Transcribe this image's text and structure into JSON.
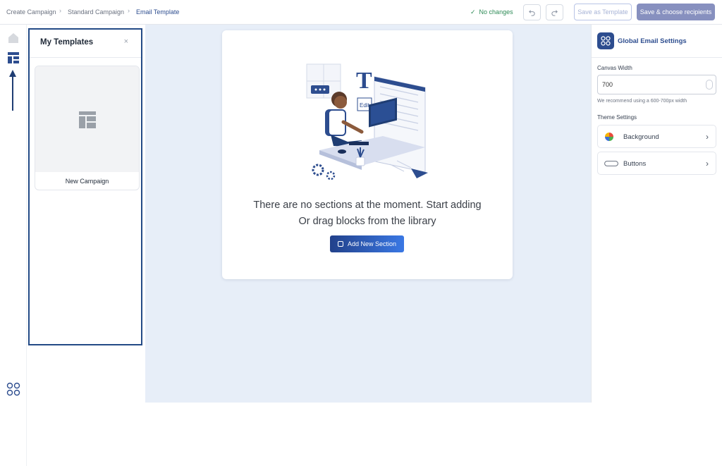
{
  "breadcrumb": {
    "items": [
      "Create Campaign",
      "Standard Campaign",
      "Email Template"
    ],
    "separator": "›"
  },
  "toolbar": {
    "status": "No changes",
    "undo_icon": "undo-icon",
    "redo_icon": "redo-icon",
    "save_template_label": "Save as Template",
    "save_recipients_label": "Save & choose recipients"
  },
  "rail": {
    "icons": [
      "home-icon",
      "templates-icon",
      "apps-icon"
    ]
  },
  "templates_panel": {
    "title": "My Templates",
    "close_icon": "×",
    "templates": [
      {
        "name": "New Campaign"
      }
    ]
  },
  "canvas": {
    "empty_line1": "There are no sections at the moment. Start adding",
    "empty_line2": "Or drag blocks from the library",
    "add_section_label": "Add New Section",
    "illustration": "illustration: person working at a computer"
  },
  "settings": {
    "title": "Global Email Settings",
    "canvas_width_label": "Canvas Width",
    "canvas_width_value": "700",
    "canvas_width_hint": "We recommend using a 600-700px width",
    "theme_settings_label": "Theme Settings",
    "rows": [
      {
        "label": "Background",
        "icon": "color-wheel-icon"
      },
      {
        "label": "Buttons",
        "icon": "button-shape-icon"
      }
    ]
  },
  "colors": {
    "accent": "#2d4d8f",
    "status_ok": "#2e8b57",
    "canvas_bg": "#e7eef8",
    "panel_border": "#234a86"
  }
}
